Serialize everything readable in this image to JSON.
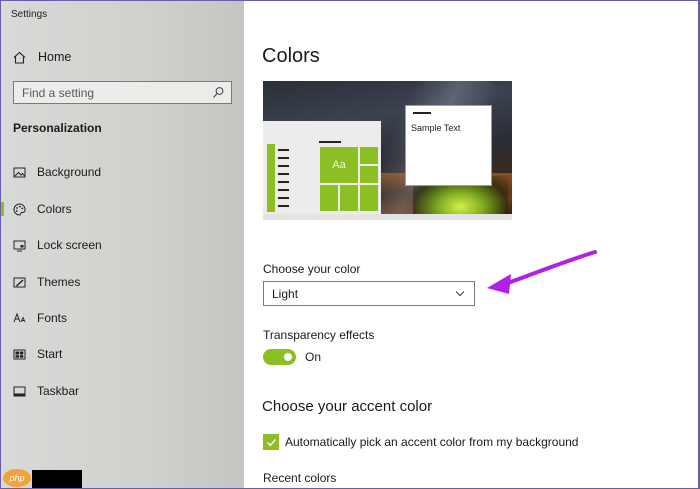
{
  "window": {
    "title": "Settings"
  },
  "sidebar": {
    "home_label": "Home",
    "search_placeholder": "Find a setting",
    "section_heading": "Personalization",
    "items": [
      {
        "label": "Background",
        "icon": "picture-icon",
        "active": false
      },
      {
        "label": "Colors",
        "icon": "palette-icon",
        "active": true
      },
      {
        "label": "Lock screen",
        "icon": "lock-screen-icon",
        "active": false
      },
      {
        "label": "Themes",
        "icon": "themes-icon",
        "active": false
      },
      {
        "label": "Fonts",
        "icon": "fonts-icon",
        "active": false
      },
      {
        "label": "Start",
        "icon": "start-icon",
        "active": false
      },
      {
        "label": "Taskbar",
        "icon": "taskbar-icon",
        "active": false
      }
    ]
  },
  "watermark": {
    "text": "php"
  },
  "main": {
    "title": "Colors",
    "preview": {
      "tile_text": "Aa",
      "sample_text": "Sample Text"
    },
    "choose_color": {
      "label": "Choose your color",
      "selected": "Light"
    },
    "transparency": {
      "label": "Transparency effects",
      "state": "On"
    },
    "accent": {
      "title": "Choose your accent color",
      "auto_pick_label": "Automatically pick an accent color from my background",
      "auto_pick_checked": true,
      "recent_colors_label": "Recent colors"
    }
  },
  "colors": {
    "accent": "#8cbf24",
    "annotation_arrow": "#b31fe6"
  }
}
